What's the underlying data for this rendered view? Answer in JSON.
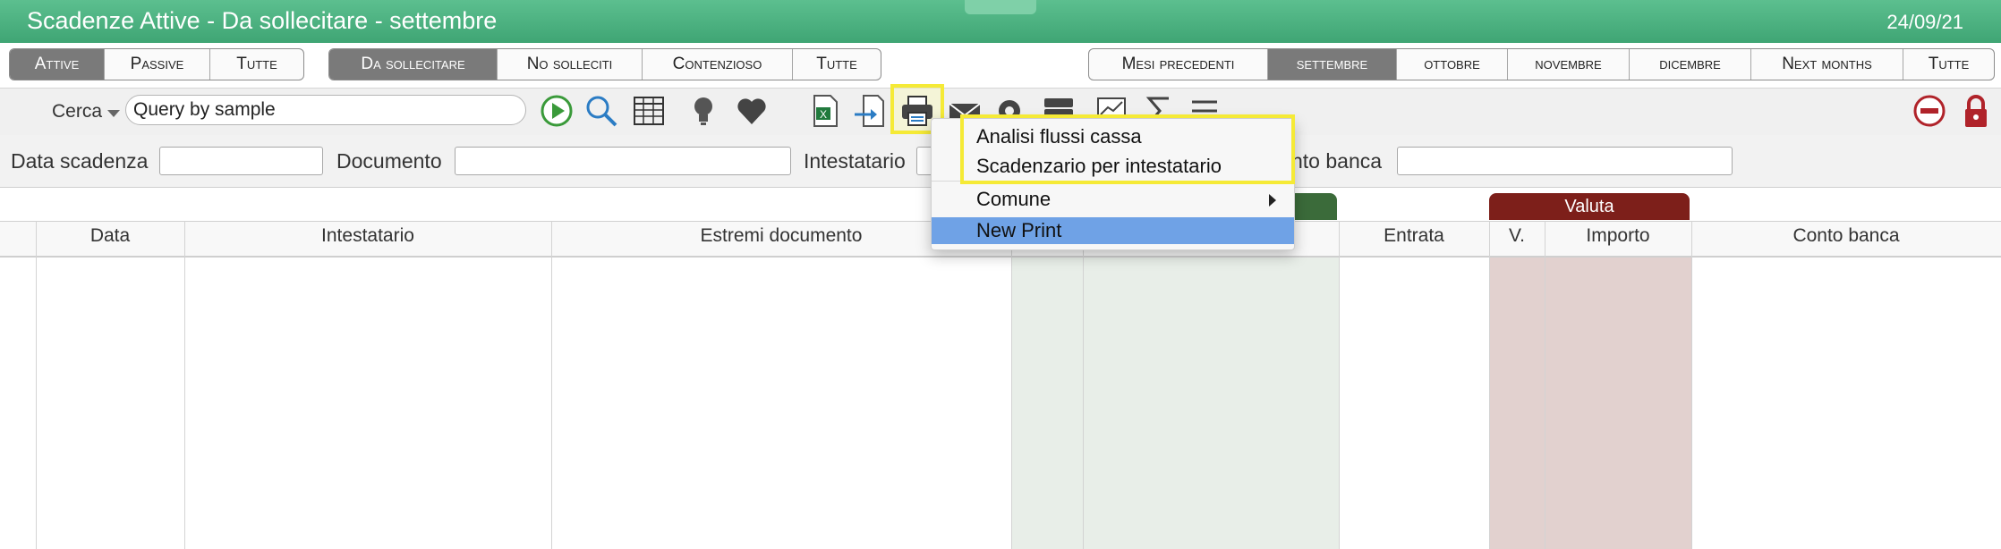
{
  "window": {
    "title": "Scadenze Attive - Da sollecitare - settembre",
    "date": "24/09/21"
  },
  "seg_type": [
    "Attive",
    "Passive",
    "Tutte"
  ],
  "seg_status": [
    "Da sollecitare",
    "No solleciti",
    "Contenzioso",
    "Tutte"
  ],
  "seg_months": [
    "Mesi precedenti",
    "settembre",
    "ottobre",
    "novembre",
    "dicembre",
    "Next months",
    "Tutte"
  ],
  "search": {
    "label": "Cerca",
    "value": "Query by sample"
  },
  "filters": {
    "data_scadenza": "Data scadenza",
    "documento": "Documento",
    "intestatario": "Intestatario",
    "conto_banca": "nto banca"
  },
  "groups": {
    "valuta": "Valuta"
  },
  "columns": {
    "data": "Data",
    "intestatario": "Intestatario",
    "estremi": "Estremi documento",
    "entrata": "Entrata",
    "v": "V.",
    "importo": "Importo",
    "conto_banca": "Conto banca"
  },
  "print_menu": {
    "items": [
      "Analisi flussi cassa",
      "Scadenzario per intestatario",
      "Comune",
      "New Print"
    ]
  },
  "colors": {
    "title_green": "#4fb382",
    "valuta_red": "#7d1f1a",
    "green_group": "#3b6b3a",
    "menu_selected": "#6fa2e6",
    "highlight": "#f5ea36"
  },
  "icons": [
    "play-icon",
    "search-icon",
    "table-icon",
    "lightbulb-icon",
    "heart-icon",
    "excel-icon",
    "import-icon",
    "print-icon",
    "mail-icon",
    "gear-icon",
    "stack-icon",
    "chart-icon",
    "sigma-icon",
    "list-icon",
    "remove-icon",
    "lock-icon"
  ]
}
